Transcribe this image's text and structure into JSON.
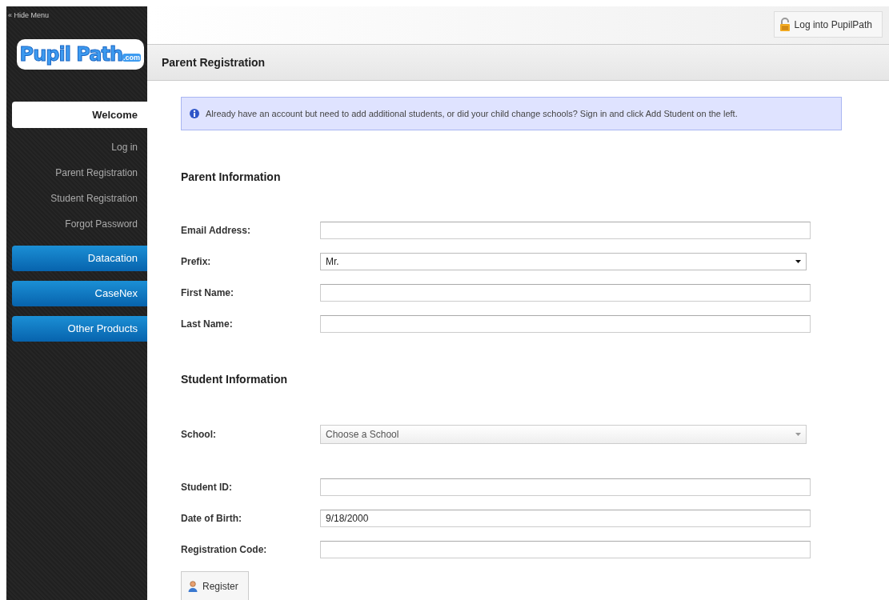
{
  "sidebar": {
    "hide_menu": "« Hide Menu",
    "logo": {
      "name": "Pupil Path",
      "suffix": ".com"
    },
    "items": [
      {
        "label": "Welcome",
        "kind": "tab",
        "selected": true
      },
      {
        "label": "Log in",
        "kind": "link",
        "selected": false
      },
      {
        "label": "Parent Registration",
        "kind": "link",
        "selected": false
      },
      {
        "label": "Student Registration",
        "kind": "link",
        "selected": false
      },
      {
        "label": "Forgot Password",
        "kind": "link",
        "selected": false
      },
      {
        "label": "Datacation",
        "kind": "product",
        "selected": false
      },
      {
        "label": "CaseNex",
        "kind": "product",
        "selected": false
      },
      {
        "label": "Other Products",
        "kind": "product",
        "selected": false
      }
    ]
  },
  "top_bar": {
    "login_button": "Log into PupilPath"
  },
  "page": {
    "title": "Parent Registration",
    "notice": "Already have an account but need to add additional students, or did your child change schools? Sign in and click Add Student on the left.",
    "sections": [
      {
        "title": "Parent Information",
        "fields": [
          {
            "label": "Email Address:",
            "kind": "text"
          },
          {
            "label": "Prefix:",
            "kind": "select",
            "value": "Mr."
          },
          {
            "label": "First Name:",
            "kind": "text"
          },
          {
            "label": "Last Name:",
            "kind": "text"
          }
        ]
      },
      {
        "title": "Student Information",
        "fields": [
          {
            "label": "School:",
            "kind": "combo",
            "placeholder": "Choose a School"
          },
          {
            "label": "Student ID:",
            "kind": "text"
          },
          {
            "label": "Date of Birth:",
            "kind": "text",
            "value": "9/18/2000"
          },
          {
            "label": "Registration Code:",
            "kind": "text"
          }
        ]
      }
    ],
    "submit": "Register"
  }
}
